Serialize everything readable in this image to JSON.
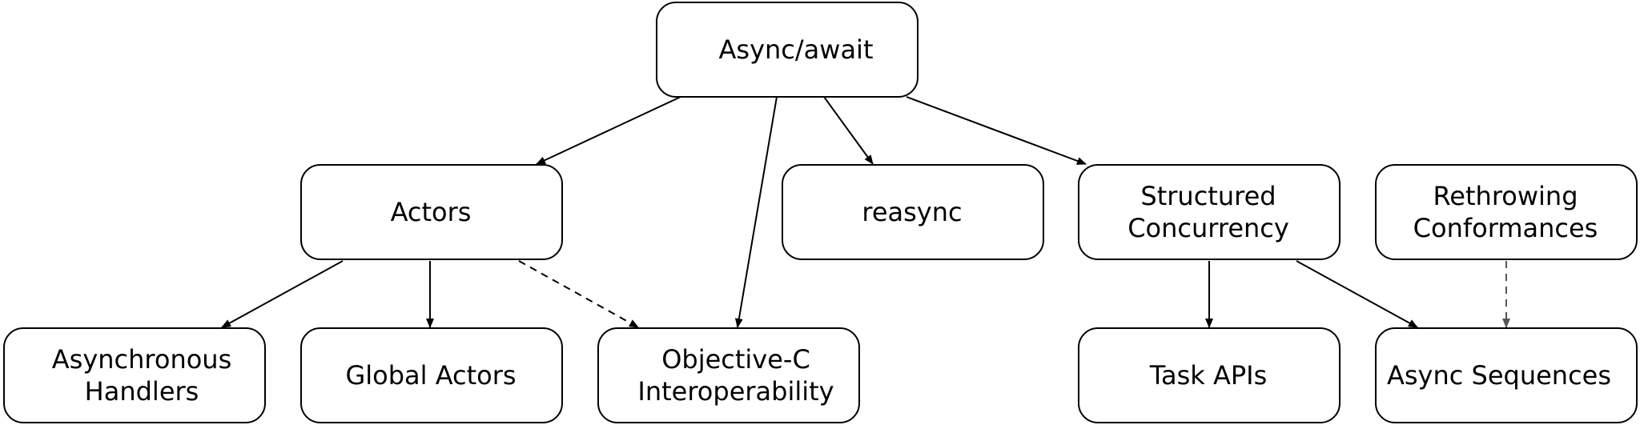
{
  "nodes": [
    {
      "id": "async-await",
      "lines": [
        "Async/await"
      ]
    },
    {
      "id": "actors",
      "lines": [
        "Actors"
      ]
    },
    {
      "id": "reasync",
      "lines": [
        "reasync"
      ]
    },
    {
      "id": "structured-concurrency",
      "lines": [
        "Structured",
        "Concurrency"
      ]
    },
    {
      "id": "rethrowing-conformances",
      "lines": [
        "Rethrowing",
        "Conformances"
      ]
    },
    {
      "id": "asynchronous-handlers",
      "lines": [
        "Asynchronous",
        "Handlers"
      ]
    },
    {
      "id": "global-actors",
      "lines": [
        "Global Actors"
      ]
    },
    {
      "id": "objective-c-interoperability",
      "lines": [
        "Objective-C",
        "Interoperability"
      ]
    },
    {
      "id": "task-apis",
      "lines": [
        "Task APIs"
      ]
    },
    {
      "id": "async-sequences",
      "lines": [
        "Async Sequences"
      ]
    }
  ],
  "edges": [
    {
      "from": "async-await",
      "to": "actors",
      "style": "solid"
    },
    {
      "from": "async-await",
      "to": "objective-c-interoperability",
      "style": "solid"
    },
    {
      "from": "async-await",
      "to": "reasync",
      "style": "solid"
    },
    {
      "from": "async-await",
      "to": "structured-concurrency",
      "style": "solid"
    },
    {
      "from": "actors",
      "to": "asynchronous-handlers",
      "style": "solid"
    },
    {
      "from": "actors",
      "to": "global-actors",
      "style": "solid"
    },
    {
      "from": "actors",
      "to": "objective-c-interoperability",
      "style": "dashed"
    },
    {
      "from": "structured-concurrency",
      "to": "task-apis",
      "style": "solid"
    },
    {
      "from": "structured-concurrency",
      "to": "async-sequences",
      "style": "solid"
    },
    {
      "from": "rethrowing-conformances",
      "to": "async-sequences",
      "style": "dashed"
    }
  ],
  "colors": {
    "stroke": "#000000",
    "dashed_gray": "#555555",
    "background": "#ffffff"
  }
}
